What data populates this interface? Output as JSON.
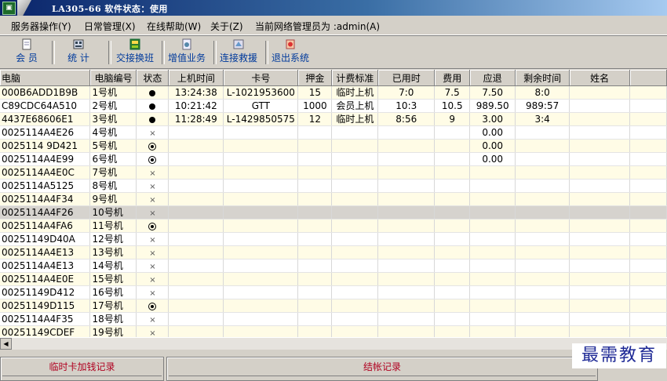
{
  "window": {
    "title": "LA305-66  软件状态：使用"
  },
  "menu": [
    {
      "label": "服务器操作(Y)"
    },
    {
      "label": "日常管理(X)"
    },
    {
      "label": "在线帮助(W)"
    },
    {
      "label": "关于(Z)"
    },
    {
      "label": "当前网络管理员为 :admin(A)"
    }
  ],
  "toolbar": [
    {
      "label": "会  员",
      "icon": "member-icon"
    },
    {
      "label": "统  计",
      "icon": "stats-icon"
    },
    {
      "label": "交接换班",
      "icon": "handover-icon"
    },
    {
      "label": "增值业务",
      "icon": "value-added-icon"
    },
    {
      "label": "连接救援",
      "icon": "rescue-icon"
    },
    {
      "label": "退出系统",
      "icon": "exit-icon"
    }
  ],
  "columns": [
    "电脑",
    "电脑编号",
    "状态",
    "上机时间",
    "卡号",
    "押金",
    "计费标准",
    "已用时",
    "费用",
    "应退",
    "剩余时间",
    "姓名"
  ],
  "rows": [
    {
      "computer": "000B6ADD1B9B",
      "number": "1号机",
      "status": "online",
      "start": "13:24:38",
      "card": "L-1021953600",
      "deposit": "15",
      "rate": "临时上机",
      "used": "7:0",
      "fee": "7.5",
      "refund": "7.50",
      "remain": "8:0",
      "name": ""
    },
    {
      "computer": "C89CDC64A510",
      "number": "2号机",
      "status": "online",
      "start": "10:21:42",
      "card": "GTT",
      "deposit": "1000",
      "rate": "会员上机",
      "used": "10:3",
      "fee": "10.5",
      "refund": "989.50",
      "remain": "989:57",
      "name": ""
    },
    {
      "computer": "4437E68606E1",
      "number": "3号机",
      "status": "online",
      "start": "11:28:49",
      "card": "L-1429850575",
      "deposit": "12",
      "rate": "临时上机",
      "used": "8:56",
      "fee": "9",
      "refund": "3.00",
      "remain": "3:4",
      "name": ""
    },
    {
      "computer": "0025114A4E26",
      "number": "4号机",
      "status": "off",
      "start": "",
      "card": "",
      "deposit": "",
      "rate": "",
      "used": "",
      "fee": "",
      "refund": "0.00",
      "remain": "",
      "name": ""
    },
    {
      "computer": "0025114 9D421",
      "number": "5号机",
      "status": "idle",
      "start": "",
      "card": "",
      "deposit": "",
      "rate": "",
      "used": "",
      "fee": "",
      "refund": "0.00",
      "remain": "",
      "name": ""
    },
    {
      "computer": "0025114A4E99",
      "number": "6号机",
      "status": "idle",
      "start": "",
      "card": "",
      "deposit": "",
      "rate": "",
      "used": "",
      "fee": "",
      "refund": "0.00",
      "remain": "",
      "name": ""
    },
    {
      "computer": "0025114A4E0C",
      "number": "7号机",
      "status": "off",
      "start": "",
      "card": "",
      "deposit": "",
      "rate": "",
      "used": "",
      "fee": "",
      "refund": "",
      "remain": "",
      "name": ""
    },
    {
      "computer": "0025114A5125",
      "number": "8号机",
      "status": "off",
      "start": "",
      "card": "",
      "deposit": "",
      "rate": "",
      "used": "",
      "fee": "",
      "refund": "",
      "remain": "",
      "name": ""
    },
    {
      "computer": "0025114A4F34",
      "number": "9号机",
      "status": "off",
      "start": "",
      "card": "",
      "deposit": "",
      "rate": "",
      "used": "",
      "fee": "",
      "refund": "",
      "remain": "",
      "name": ""
    },
    {
      "computer": "0025114A4F26",
      "number": "10号机",
      "status": "off",
      "start": "",
      "card": "",
      "deposit": "",
      "rate": "",
      "used": "",
      "fee": "",
      "refund": "",
      "remain": "",
      "name": "",
      "selected": true
    },
    {
      "computer": "0025114A4FA6",
      "number": "11号机",
      "status": "idle",
      "start": "",
      "card": "",
      "deposit": "",
      "rate": "",
      "used": "",
      "fee": "",
      "refund": "",
      "remain": "",
      "name": ""
    },
    {
      "computer": "00251149D40A",
      "number": "12号机",
      "status": "off",
      "start": "",
      "card": "",
      "deposit": "",
      "rate": "",
      "used": "",
      "fee": "",
      "refund": "",
      "remain": "",
      "name": ""
    },
    {
      "computer": "0025114A4E13",
      "number": "13号机",
      "status": "off",
      "start": "",
      "card": "",
      "deposit": "",
      "rate": "",
      "used": "",
      "fee": "",
      "refund": "",
      "remain": "",
      "name": ""
    },
    {
      "computer": "0025114A4E13",
      "number": "14号机",
      "status": "off",
      "start": "",
      "card": "",
      "deposit": "",
      "rate": "",
      "used": "",
      "fee": "",
      "refund": "",
      "remain": "",
      "name": ""
    },
    {
      "computer": "0025114A4E0E",
      "number": "15号机",
      "status": "off",
      "start": "",
      "card": "",
      "deposit": "",
      "rate": "",
      "used": "",
      "fee": "",
      "refund": "",
      "remain": "",
      "name": ""
    },
    {
      "computer": "00251149D412",
      "number": "16号机",
      "status": "off",
      "start": "",
      "card": "",
      "deposit": "",
      "rate": "",
      "used": "",
      "fee": "",
      "refund": "",
      "remain": "",
      "name": ""
    },
    {
      "computer": "00251149D115",
      "number": "17号机",
      "status": "idle",
      "start": "",
      "card": "",
      "deposit": "",
      "rate": "",
      "used": "",
      "fee": "",
      "refund": "",
      "remain": "",
      "name": ""
    },
    {
      "computer": "0025114A4F35",
      "number": "18号机",
      "status": "off",
      "start": "",
      "card": "",
      "deposit": "",
      "rate": "",
      "used": "",
      "fee": "",
      "refund": "",
      "remain": "",
      "name": ""
    },
    {
      "computer": "00251149CDEF",
      "number": "19号机",
      "status": "off",
      "start": "",
      "card": "",
      "deposit": "",
      "rate": "",
      "used": "",
      "fee": "",
      "refund": "",
      "remain": "",
      "name": ""
    }
  ],
  "status_symbols": {
    "online": "●",
    "idle": "⊙",
    "off": "×"
  },
  "panels": {
    "temp_card": "临时卡加钱记录",
    "checkout": "结帐记录"
  },
  "watermark": "最需教育"
}
